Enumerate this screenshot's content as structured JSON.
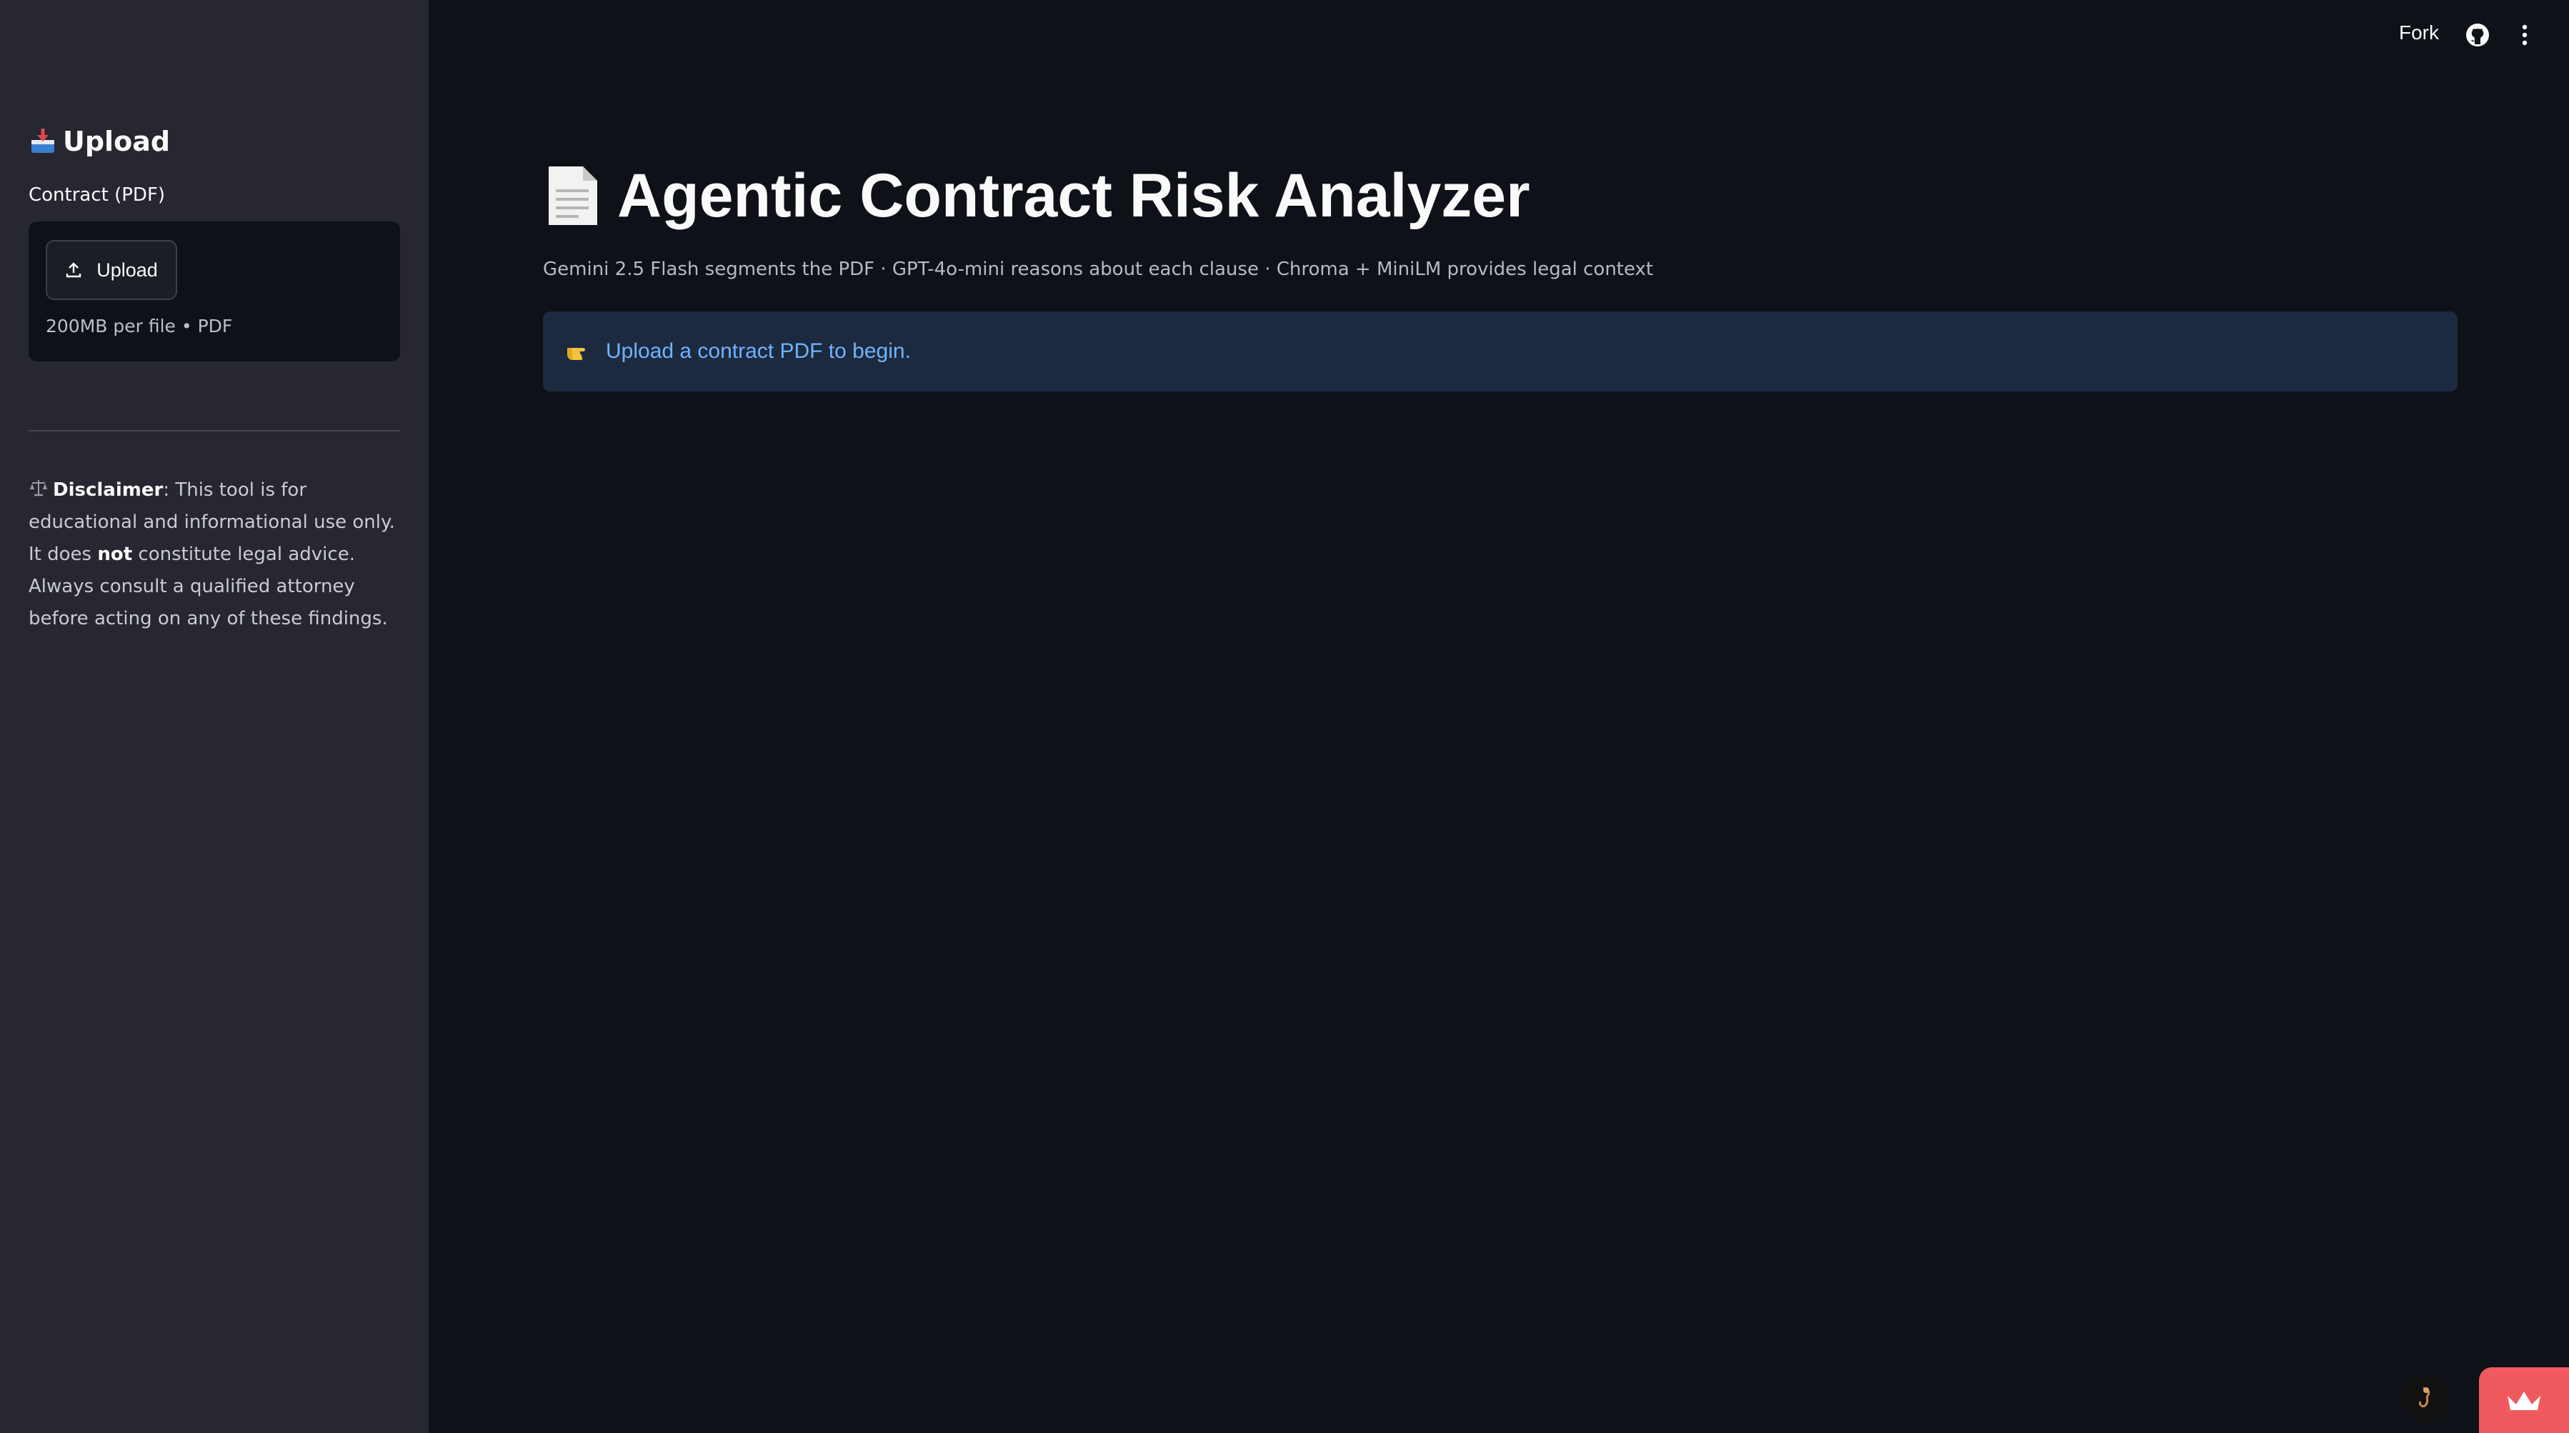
{
  "sidebar": {
    "header": "Upload",
    "header_icon": "inbox-tray-icon",
    "uploader_label": "Contract (PDF)",
    "upload_button_label": "Upload",
    "upload_limit": "200MB per file • PDF",
    "disclaimer": {
      "label": "Disclaimer",
      "text_1": ": This tool is for educational and informational use only. It does ",
      "emphasis": "not",
      "text_2": " constitute legal advice. Always consult a qualified attorney before acting on any of these findings."
    }
  },
  "toolbar": {
    "fork_label": "Fork",
    "github_icon": "github-icon",
    "menu_icon": "vertical-dots-icon"
  },
  "main": {
    "title": "Agentic Contract Risk Analyzer",
    "title_icon": "page-document-icon",
    "caption": "Gemini 2.5 Flash segments the PDF · GPT-4o-mini reasons about each clause · Chroma + MiniLM provides legal context",
    "info_message": "Upload a contract PDF to begin.",
    "info_icon": "pointing-hand-icon"
  },
  "colors": {
    "background": "#0e1117",
    "sidebar": "#262730",
    "info_bg": "#1c2a3f",
    "info_text": "#6fb2ff",
    "badge": "#f05a5f"
  }
}
